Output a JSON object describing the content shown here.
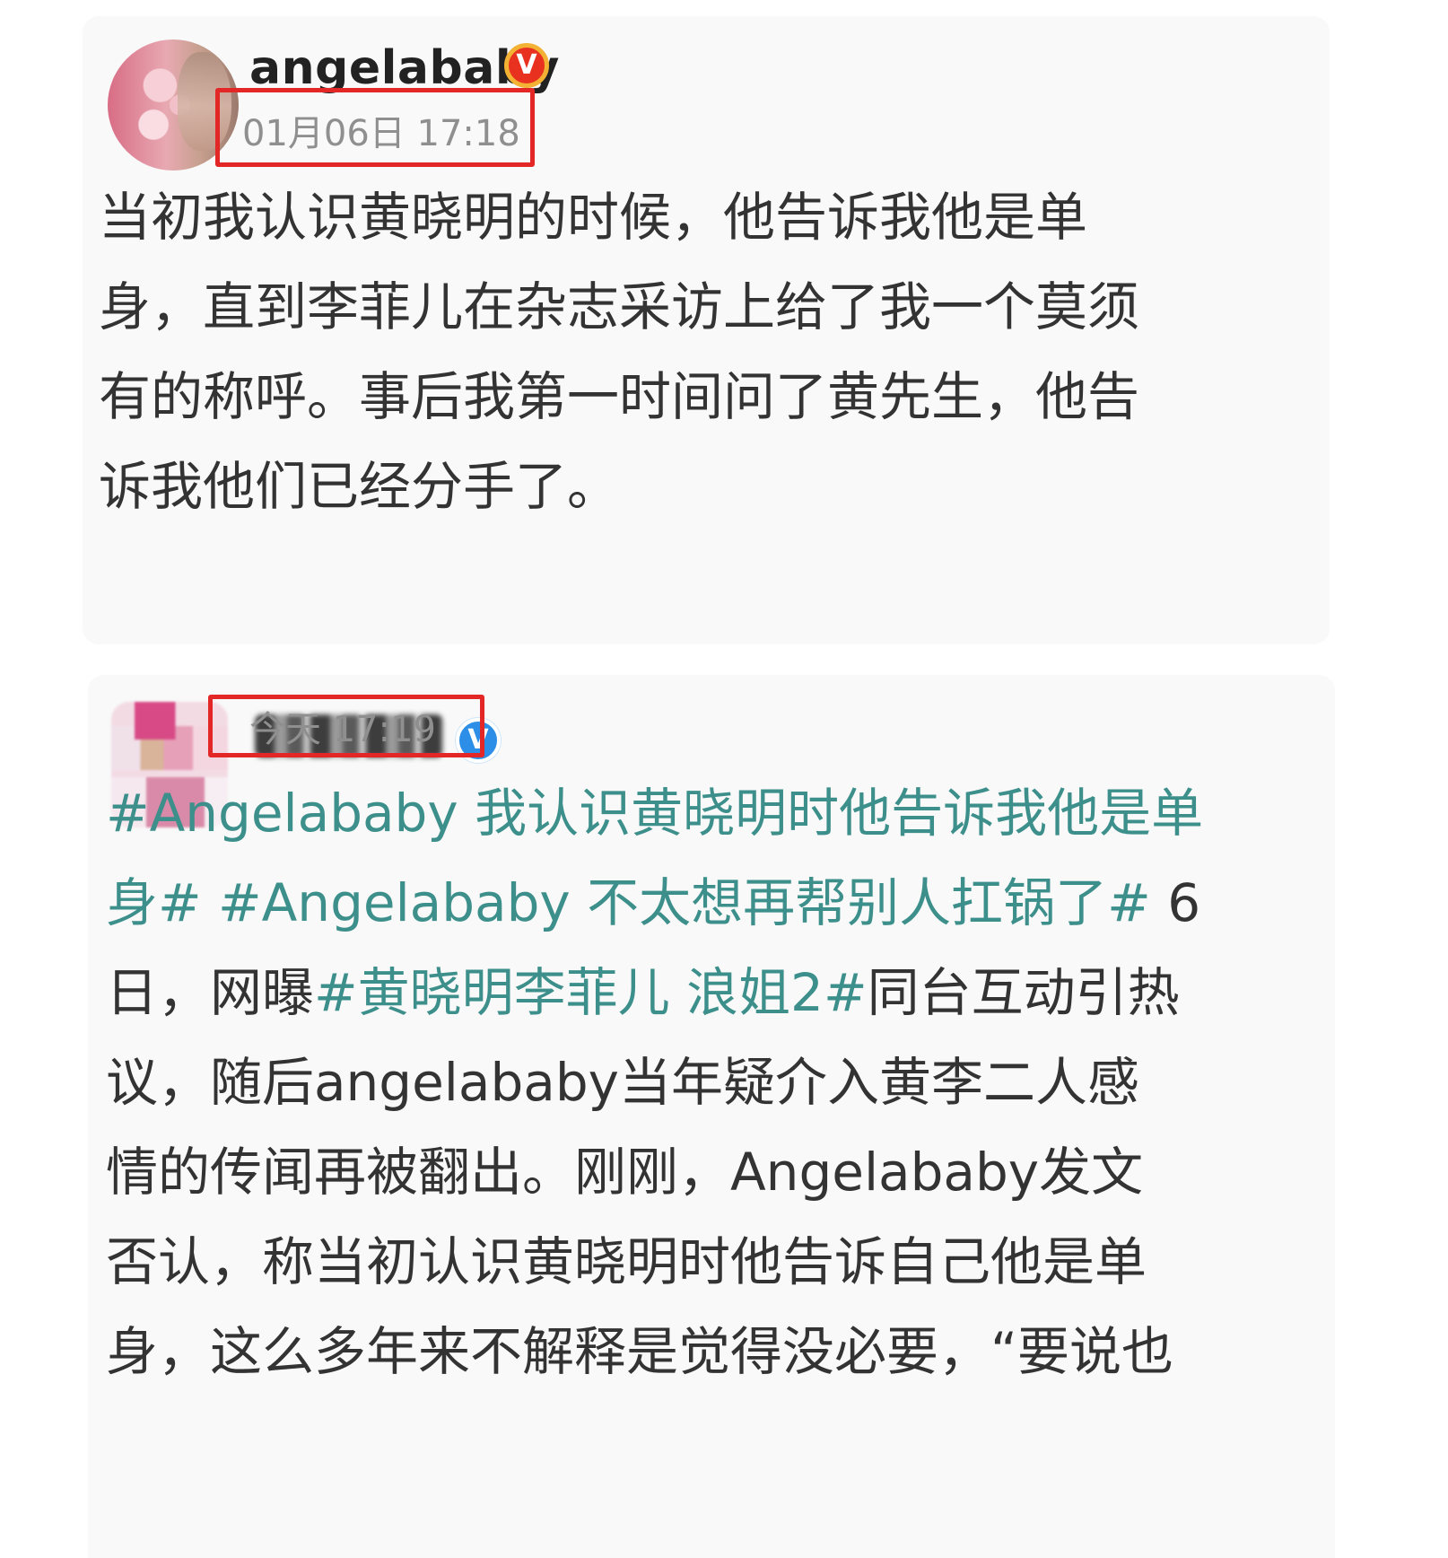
{
  "post1": {
    "username": "angelababy",
    "verified_badge": "V",
    "time": "01月06日 17:18",
    "text_lines": [
      "当初我认识黄晓明的时候，他告诉我他是单",
      "身，直到李菲儿在杂志采访上给了我一个莫须",
      "有的称呼。事后我第一时间问了黄先生，他告",
      "诉我他们已经分手了。"
    ]
  },
  "post2": {
    "verified_badge": "V",
    "time": "今天 17:19",
    "lines": [
      {
        "tag1": "#Angelababy 我认识黄晓明时他告诉我他是单"
      },
      {
        "tag1": "身# #Angelababy 不太想再帮别人扛锅了#",
        "text1": " 6"
      },
      {
        "text1": "日，网曝",
        "tag1": "#黄晓明李菲儿 浪姐2#",
        "text2": "同台互动引热"
      },
      {
        "text1": "议，随后angelababy当年疑介入黄李二人感"
      },
      {
        "text1": "情的传闻再被翻出。刚刚，Angelababy发文"
      },
      {
        "text1": "否认，称当初认识黄晓明时他告诉自己他是单"
      },
      {
        "text1": "身，这么多年来不解释是觉得没必要，“要说也"
      }
    ]
  },
  "colors": {
    "hashtag": "#3c8f8a",
    "highlight_box": "#e32626",
    "gold_badge": "#e8321f",
    "blue_badge": "#2c8ee6"
  }
}
